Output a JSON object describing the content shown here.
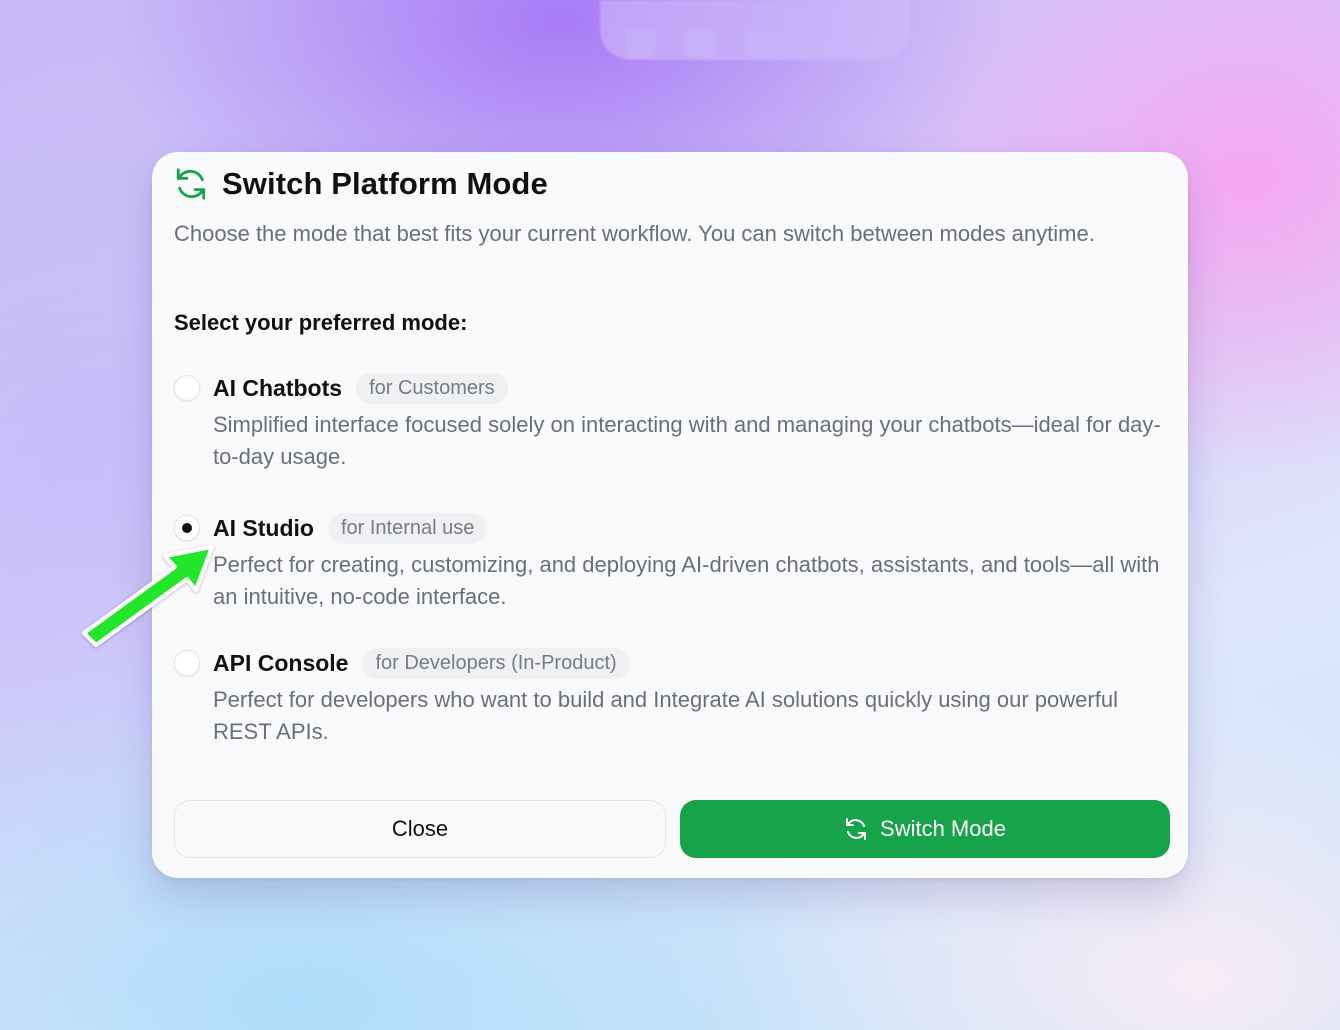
{
  "dialog": {
    "title": "Switch Platform Mode",
    "subtitle": "Choose the mode that best fits your current workflow. You can switch between modes anytime.",
    "section_label": "Select your preferred mode:",
    "options": [
      {
        "title": "AI Chatbots",
        "badge": "for Customers",
        "description": "Simplified interface focused solely on interacting with and managing your chatbots—ideal for day-to-day usage.",
        "selected": false
      },
      {
        "title": "AI Studio",
        "badge": "for Internal use",
        "description": "Perfect for creating, customizing, and deploying AI-driven chatbots, assistants, and tools—all with an intuitive, no-code interface.",
        "selected": true
      },
      {
        "title": "API Console",
        "badge": "for Developers (In-Product)",
        "description": "Perfect for developers who want to build and Integrate AI solutions quickly using our powerful REST APIs.",
        "selected": false
      }
    ],
    "close_label": "Close",
    "switch_label": "Switch Mode"
  },
  "colors": {
    "accent": "#16a34a",
    "annotation_arrow": "#22e62a"
  },
  "icons": {
    "header": "refresh-icon",
    "switch_button": "refresh-icon",
    "annotation": "arrow-icon"
  }
}
